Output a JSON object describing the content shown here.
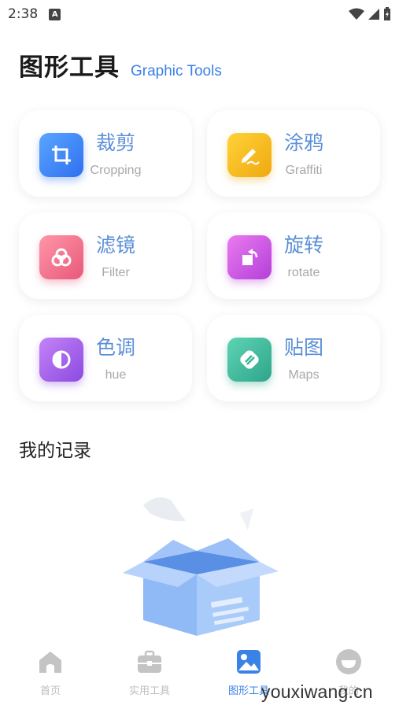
{
  "status_bar": {
    "time": "2:38",
    "notification_badge": "A"
  },
  "header": {
    "title": "图形工具",
    "subtitle": "Graphic Tools"
  },
  "tools": [
    {
      "zh": "裁剪",
      "en": "Cropping",
      "icon": "crop-icon"
    },
    {
      "zh": "涂鸦",
      "en": "Graffiti",
      "icon": "pen-icon"
    },
    {
      "zh": "滤镜",
      "en": "Filter",
      "icon": "filter-icon"
    },
    {
      "zh": "旋转",
      "en": "rotate",
      "icon": "rotate-icon"
    },
    {
      "zh": "色调",
      "en": "hue",
      "icon": "contrast-icon"
    },
    {
      "zh": "贴图",
      "en": "Maps",
      "icon": "sticker-icon"
    }
  ],
  "records": {
    "title": "我的记录"
  },
  "bottom_nav": [
    {
      "label": "首页",
      "icon": "home-icon",
      "active": false
    },
    {
      "label": "实用工具",
      "icon": "toolbox-icon",
      "active": false
    },
    {
      "label": "图形工具",
      "icon": "image-icon",
      "active": true
    },
    {
      "label": "我的",
      "icon": "profile-icon",
      "active": false
    }
  ],
  "watermark": "youxiwang.cn",
  "colors": {
    "accent": "#3b82e6",
    "crop": "#3f8cf5",
    "graffiti": "#f7b515",
    "filter": "#ef6f8a",
    "rotate": "#c94fe0",
    "hue": "#9b5ce8",
    "maps": "#36b79a"
  }
}
